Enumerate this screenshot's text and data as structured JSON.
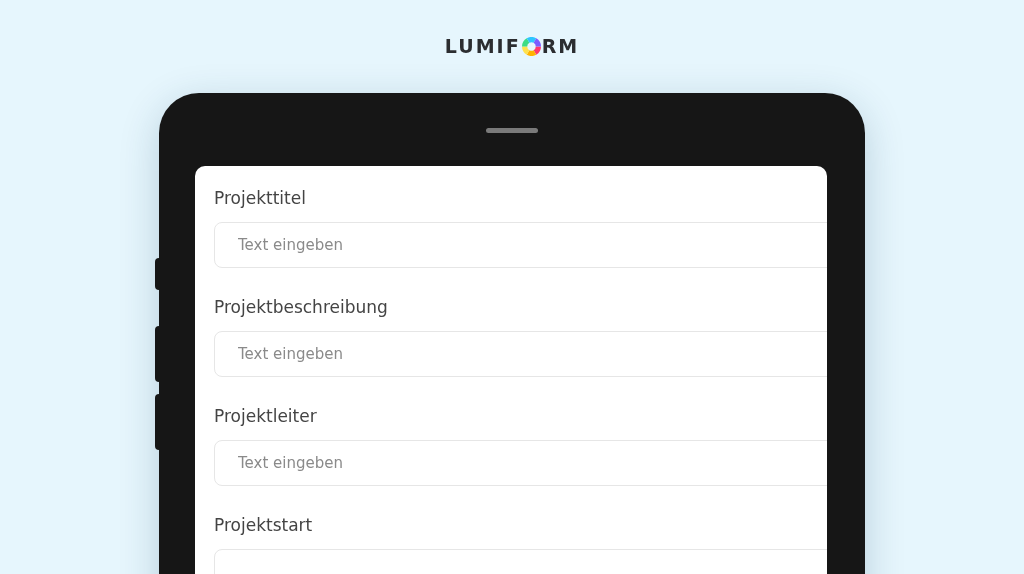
{
  "logo": {
    "before": "LUMIF",
    "after": "RM"
  },
  "form": {
    "fields": [
      {
        "label": "Projekttitel",
        "placeholder": "Text eingeben"
      },
      {
        "label": "Projektbeschreibung",
        "placeholder": "Text eingeben"
      },
      {
        "label": "Projektleiter",
        "placeholder": "Text eingeben"
      },
      {
        "label": "Projektstart"
      }
    ]
  }
}
